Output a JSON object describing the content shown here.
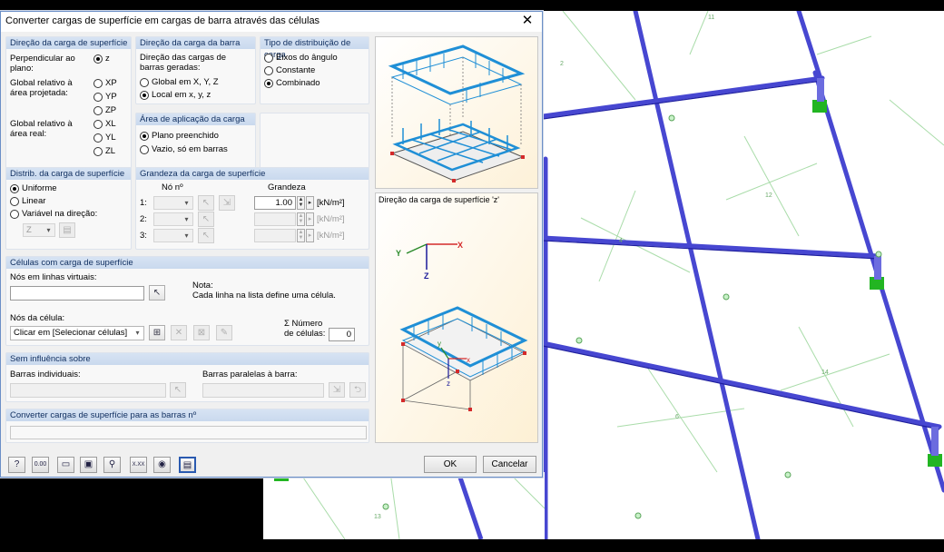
{
  "window": {
    "title": "Converter cargas de superfície em cargas de barra através das células",
    "close": "✕"
  },
  "dir_surface": {
    "header": "Direção da carga de superfície",
    "perp_label": "Perpendicular ao plano:",
    "proj_label": "Global relativo à área projetada:",
    "real_label": "Global relativo à área real:",
    "opt_z": "z",
    "opt_xp": "XP",
    "opt_yp": "YP",
    "opt_zp": "ZP",
    "opt_xl": "XL",
    "opt_yl": "YL",
    "opt_zl": "ZL"
  },
  "dir_member": {
    "header": "Direção da carga da barra",
    "desc": "Direção das cargas de barras geradas:",
    "opt_global": "Global em X, Y, Z",
    "opt_local": "Local em x, y, z"
  },
  "dist_type": {
    "header": "Tipo de distribuição de carga",
    "opt_angle": "Eixos do ângulo",
    "opt_const": "Constante",
    "opt_comb": "Combinado"
  },
  "area": {
    "header": "Área de aplicação da carga",
    "opt_filled": "Plano preenchido",
    "opt_empty": "Vazio, só em barras"
  },
  "distrib": {
    "header": "Distrib. da carga de superfície",
    "opt_uniform": "Uniforme",
    "opt_linear": "Linear",
    "opt_var": "Variável na direção:",
    "dir_value": "Z"
  },
  "magnitude": {
    "header": "Grandeza da carga de superfície",
    "col_node": "Nó nº",
    "col_mag": "Grandeza",
    "rows": [
      {
        "label": "1:",
        "value": "1.00",
        "unit": "[kN/m²]"
      },
      {
        "label": "2:",
        "value": "",
        "unit": "[kN/m²]"
      },
      {
        "label": "3:",
        "value": "",
        "unit": "[kN/m²]"
      }
    ]
  },
  "cells": {
    "header": "Células com carga de superfície",
    "virtual_label": "Nós em linhas virtuais:",
    "virtual_value": "",
    "note_title": "Nota:",
    "note_text": "Cada linha na lista define uma célula.",
    "cell_nodes_label": "Nós da célula:",
    "cell_select": "Clicar em [Selecionar células]",
    "count_label_1": "Σ Número",
    "count_label_2": "de células:",
    "count_value": "0"
  },
  "no_influence": {
    "header": "Sem influência sobre",
    "single_label": "Barras individuais:",
    "parallel_label": "Barras paralelas à barra:"
  },
  "convert": {
    "header": "Converter cargas de superfície para as barras nº",
    "value": ""
  },
  "preview": {
    "caption": "Direção da carga de superfície 'z'",
    "axis_x": "X",
    "axis_y": "Y",
    "axis_z": "Z",
    "local_x": "x",
    "local_y": "y",
    "local_z": "z"
  },
  "buttons": {
    "ok": "OK",
    "cancel": "Cancelar"
  },
  "toolbar": {
    "icons": [
      "help-icon",
      "units-icon",
      "open-icon",
      "save-icon",
      "search-icon",
      "decimal-icon",
      "view-icon",
      "display-icon"
    ],
    "decimal_label": "0.00",
    "number_label": "X.XX"
  },
  "model": {
    "labels": [
      "11",
      "2",
      "12",
      "4",
      "14",
      "6",
      "13"
    ]
  },
  "colors": {
    "member": "#4a4ad6",
    "member_light": "#6f6ff0",
    "grid": "#9fd39f",
    "support": "#22b522",
    "header_bg": "#d2e0f2",
    "header_text": "#0f2e5f",
    "load": "#1f8fd6"
  }
}
